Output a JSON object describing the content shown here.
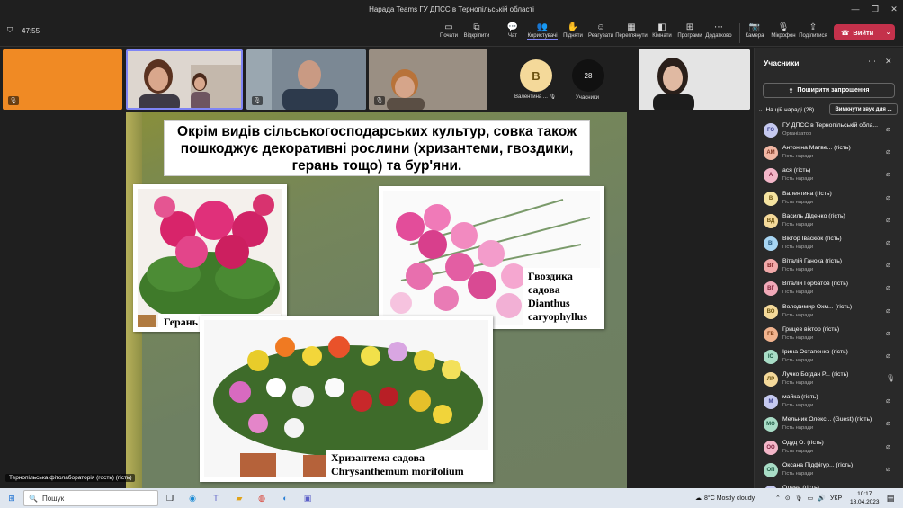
{
  "window": {
    "title": "Нарада Teams ГУ ДПСС в Тернопільській області"
  },
  "toolbar": {
    "timer": "47:55",
    "buttons": [
      {
        "label": "Почати",
        "icon": "record-icon"
      },
      {
        "label": "Відкріпити",
        "icon": "unpin-icon"
      },
      {
        "label": "Чат",
        "icon": "chat-icon"
      },
      {
        "label": "Користувачі",
        "icon": "people-icon"
      },
      {
        "label": "Підняти",
        "icon": "raise-hand-icon"
      },
      {
        "label": "Реагувати",
        "icon": "react-icon"
      },
      {
        "label": "Переглянути",
        "icon": "view-icon"
      },
      {
        "label": "Кімнати",
        "icon": "rooms-icon"
      },
      {
        "label": "Програми",
        "icon": "apps-icon"
      },
      {
        "label": "Додатково",
        "icon": "more-icon"
      },
      {
        "label": "Камера",
        "icon": "camera-icon"
      },
      {
        "label": "Мікрофон",
        "icon": "mic-off-icon"
      },
      {
        "label": "Поділитися",
        "icon": "share-icon"
      }
    ],
    "leave_label": "Вийти"
  },
  "strip": {
    "avatar_initial": "В",
    "avatar_name": "Валентина ...",
    "participants_count": "28",
    "participants_label": "Учасники"
  },
  "slide": {
    "heading": "Окрім видів сільськогосподарських культур, совка також пошкоджує декоративні рослини (хризантеми, гвоздики, герань тощо) та бур'яни.",
    "label_geranium": "Герань Geranium sp.",
    "label_carnation_1": "Гвоздика",
    "label_carnation_2": "садова",
    "label_carnation_3": "Dianthus",
    "label_carnation_4": "caryophyllus",
    "label_chrys_1": "Хризантема садова",
    "label_chrys_2": "Chrysanthemum morifolium"
  },
  "presenter_label": "Тернопільська фітолабораторія (гость) (гість)",
  "panel": {
    "title": "Учасники",
    "share_invite": "Поширити запрошення",
    "section": "На цій нараді (28)",
    "mute_all": "Вимкнути звук для ...",
    "participants": [
      {
        "initials": "ГО",
        "name": "ГУ ДПСС в Тернопільській обла...",
        "role": "Організатор",
        "color": "#c5c9ef",
        "text": "#3b3f8c"
      },
      {
        "initials": "АМ",
        "name": "Антоніна Матве... (гість)",
        "role": "Гість наради",
        "color": "#f1b7a4",
        "text": "#7a3320"
      },
      {
        "initials": "А",
        "name": "ася (гість)",
        "role": "Гість наради",
        "color": "#f3b6c8",
        "text": "#7b1f3a"
      },
      {
        "initials": "В",
        "name": "Валентина (гість)",
        "role": "Гість наради",
        "color": "#f4e3a0",
        "text": "#6b5210"
      },
      {
        "initials": "ВД",
        "name": "Василь Діденко (гість)",
        "role": "Гість наради",
        "color": "#f4d99a",
        "text": "#6b5210"
      },
      {
        "initials": "ВІ",
        "name": "Віктор Іваскюк (гість)",
        "role": "Гість наради",
        "color": "#a7d5f2",
        "text": "#1e4f75"
      },
      {
        "initials": "ВГ",
        "name": "Віталій Ганока (гість)",
        "role": "Гість наради",
        "color": "#f1a9a9",
        "text": "#7a1f1f"
      },
      {
        "initials": "ВГ",
        "name": "Віталій Горбатов (гість)",
        "role": "Гість наради",
        "color": "#f1a9b8",
        "text": "#7a1f33"
      },
      {
        "initials": "ВО",
        "name": "Володимир Охм... (гість)",
        "role": "Гість наради",
        "color": "#f4d99a",
        "text": "#6b5210"
      },
      {
        "initials": "ГВ",
        "name": "Грицев віктор (гість)",
        "role": "Гість наради",
        "color": "#f1b38e",
        "text": "#7a3a12"
      },
      {
        "initials": "ІО",
        "name": "Ірина Остапенко (гість)",
        "role": "Гість наради",
        "color": "#a8dcc6",
        "text": "#1f5a44"
      },
      {
        "initials": "ЛР",
        "name": "Лучко Богдан Р... (гість)",
        "role": "Гість наради",
        "color": "#f4d99a",
        "text": "#6b5210"
      },
      {
        "initials": "М",
        "name": "майка (гість)",
        "role": "Гість наради",
        "color": "#c5c9ef",
        "text": "#3b3f8c"
      },
      {
        "initials": "МО",
        "name": "Мельник Олекс... (Guest) (гість)",
        "role": "Гість наради",
        "color": "#a8dcc6",
        "text": "#1f5a44"
      },
      {
        "initials": "ОО",
        "name": "Одуд О. (гість)",
        "role": "Гість наради",
        "color": "#f3b6c8",
        "text": "#7b1f3a"
      },
      {
        "initials": "ОП",
        "name": "Оксана Підфігур... (гість)",
        "role": "Гість наради",
        "color": "#a8dcc6",
        "text": "#1f5a44"
      },
      {
        "initials": "О",
        "name": "Олена (гість)",
        "role": "",
        "color": "#c5c9ef",
        "text": "#3b3f8c"
      }
    ]
  },
  "taskbar": {
    "search_placeholder": "Пошук",
    "weather": "8°C  Mostly cloudy",
    "lang": "УКР",
    "time": "10:17",
    "date": "18.04.2023"
  }
}
